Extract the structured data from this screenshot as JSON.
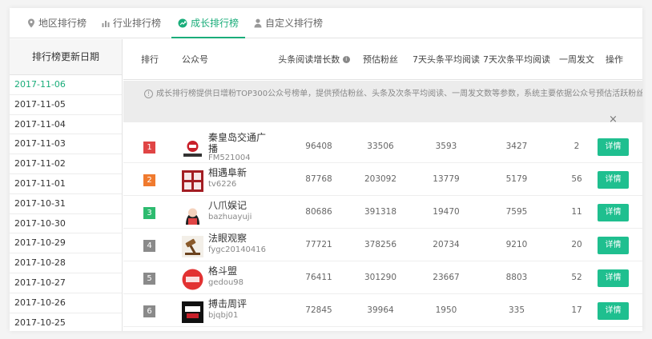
{
  "tabs": [
    {
      "label": "地区排行榜",
      "icon": "location-pin-icon",
      "active": false
    },
    {
      "label": "行业排行榜",
      "icon": "bar-chart-icon",
      "active": false
    },
    {
      "label": "成长排行榜",
      "icon": "growth-icon",
      "active": true
    },
    {
      "label": "自定义排行榜",
      "icon": "user-icon",
      "active": false
    }
  ],
  "sidebar": {
    "title": "排行榜更新日期",
    "dates": [
      "2017-11-06",
      "2017-11-05",
      "2017-11-04",
      "2017-11-03",
      "2017-11-02",
      "2017-11-01",
      "2017-10-31",
      "2017-10-30",
      "2017-10-29",
      "2017-10-28",
      "2017-10-27",
      "2017-10-26",
      "2017-10-25"
    ],
    "active_index": 0
  },
  "table": {
    "headers": {
      "rank": "排行",
      "account": "公众号",
      "growth": "头条阅读增长数",
      "fans": "预估粉丝",
      "avg_head": "7天头条平均阅读",
      "avg_second": "7天次条平均阅读",
      "weekly": "一周发文",
      "action": "操作"
    },
    "notice": "成长排行榜提供日增粉TOP300公众号榜单，提供预估粉丝、头条及次条平均阅读、一周发文数等参数，系统主要依据公众号预估活跃粉丝。",
    "close_label": "×",
    "rows": [
      {
        "rank": "1",
        "rank_color": "#e04545",
        "name": "秦皇岛交通广",
        "name2": "播",
        "account": "FM521004",
        "growth": "96408",
        "fans": "33506",
        "avg_head": "3593",
        "avg_second": "3427",
        "weekly": "2",
        "action": "详情"
      },
      {
        "rank": "2",
        "rank_color": "#f07a2e",
        "name": "相遇阜新",
        "account": "tv6226",
        "growth": "87768",
        "fans": "203092",
        "avg_head": "13779",
        "avg_second": "5179",
        "weekly": "56",
        "action": "详情"
      },
      {
        "rank": "3",
        "rank_color": "#2dbb6f",
        "name": "八爪娱记",
        "account": "bazhuayuji",
        "growth": "80686",
        "fans": "391318",
        "avg_head": "19470",
        "avg_second": "7595",
        "weekly": "11",
        "action": "详情"
      },
      {
        "rank": "4",
        "rank_color": "#8a8a8a",
        "name": "法眼观察",
        "account": "fygc20140416",
        "growth": "77721",
        "fans": "378256",
        "avg_head": "20734",
        "avg_second": "9210",
        "weekly": "20",
        "action": "详情"
      },
      {
        "rank": "5",
        "rank_color": "#8a8a8a",
        "name": "格斗盟",
        "account": "gedou98",
        "growth": "76411",
        "fans": "301290",
        "avg_head": "23667",
        "avg_second": "8803",
        "weekly": "52",
        "action": "详情"
      },
      {
        "rank": "6",
        "rank_color": "#8a8a8a",
        "name": "搏击周评",
        "account": "bjqbj01",
        "growth": "72845",
        "fans": "39964",
        "avg_head": "1950",
        "avg_second": "335",
        "weekly": "17",
        "action": "详情"
      }
    ]
  },
  "colors": {
    "accent": "#1aad7a",
    "button": "#1fbf8f"
  }
}
